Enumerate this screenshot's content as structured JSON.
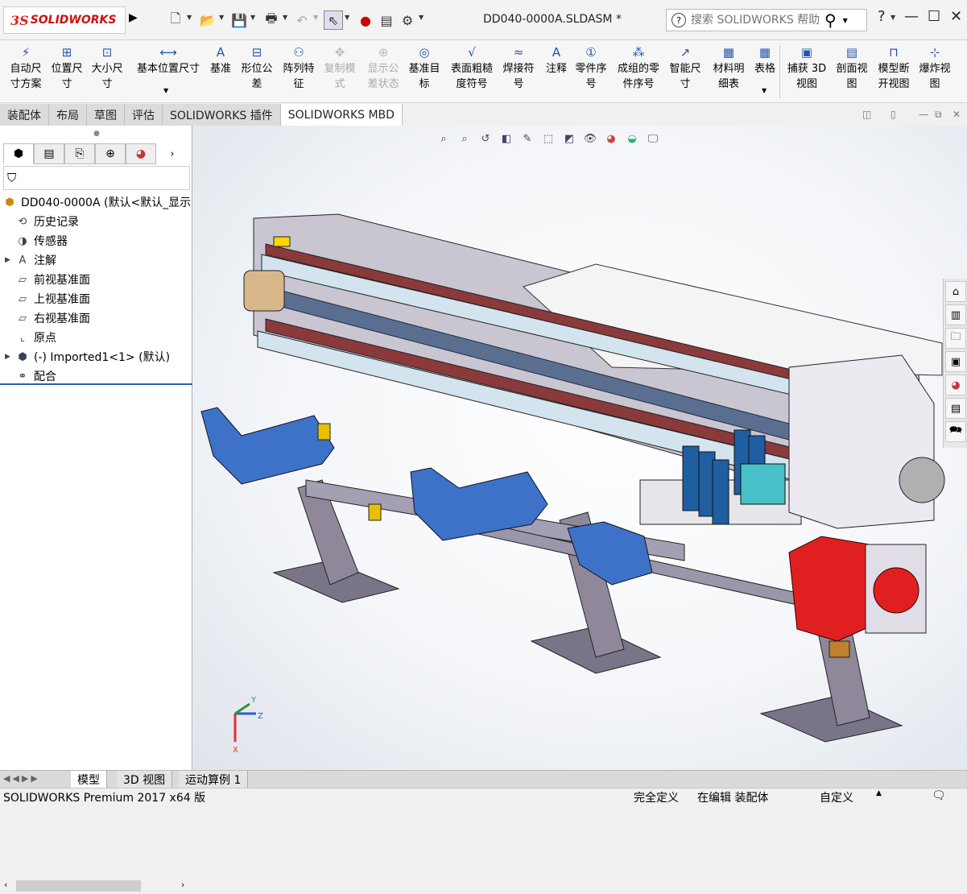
{
  "app": {
    "logo_prefix": "3S",
    "logo_text": "SOLIDWORKS",
    "document_title": "DD040-0000A.SLDASM *"
  },
  "search": {
    "placeholder": "搜索 SOLIDWORKS 帮助"
  },
  "window_controls": {
    "help": "?",
    "minimize": "—",
    "maximize": "☐",
    "close": "✕"
  },
  "ribbon": {
    "items": [
      {
        "label": "自动尺\n寸方案",
        "icon": "auto-dimension-icon"
      },
      {
        "label": "位置尺\n寸",
        "icon": "location-dimension-icon"
      },
      {
        "label": "大小尺\n寸",
        "icon": "size-dimension-icon"
      },
      {
        "label": "基本位置尺寸",
        "icon": "basic-location-dimension-icon"
      },
      {
        "label": "基准",
        "icon": "datum-icon"
      },
      {
        "label": "形位公\n差",
        "icon": "geometric-tolerance-icon"
      },
      {
        "label": "阵列特\n征",
        "icon": "pattern-feature-icon"
      },
      {
        "label": "复制模\n式",
        "icon": "copy-scheme-icon"
      },
      {
        "label": "显示公\n差状态",
        "icon": "show-tolerance-status-icon"
      },
      {
        "label": "基准目\n标",
        "icon": "datum-target-icon"
      },
      {
        "label": "表面粗糙\n度符号",
        "icon": "surface-finish-icon"
      },
      {
        "label": "焊接符\n号",
        "icon": "weld-symbol-icon"
      },
      {
        "label": "注释",
        "icon": "note-icon"
      },
      {
        "label": "零件序\n号",
        "icon": "balloon-icon"
      },
      {
        "label": "成组的零\n件序号",
        "icon": "stacked-balloon-icon"
      },
      {
        "label": "智能尺\n寸",
        "icon": "smart-dimension-icon"
      },
      {
        "label": "材料明\n细表",
        "icon": "bom-icon"
      },
      {
        "label": "表格",
        "icon": "table-icon"
      },
      {
        "label": "捕获 3D\n视图",
        "icon": "capture-3d-view-icon"
      },
      {
        "label": "剖面视\n图",
        "icon": "section-view-icon"
      },
      {
        "label": "模型断\n开视图",
        "icon": "model-break-view-icon"
      },
      {
        "label": "爆炸视\n图",
        "icon": "exploded-view-icon"
      }
    ]
  },
  "tabs": [
    "装配体",
    "布局",
    "草图",
    "评估",
    "SOLIDWORKS 插件",
    "SOLIDWORKS MBD"
  ],
  "active_tab": "SOLIDWORKS MBD",
  "tree": {
    "root": "DD040-0000A  (默认<默认_显示",
    "items": [
      "历史记录",
      "传感器",
      "注解",
      "前视基准面",
      "上视基准面",
      "右视基准面",
      "原点",
      "(-) Imported1<1> (默认)",
      "配合"
    ]
  },
  "bottom_tabs": [
    "模型",
    "3D 视图",
    "运动算例 1"
  ],
  "status": {
    "product": "SOLIDWORKS Premium 2017 x64 版",
    "definition": "完全定义",
    "editing": "在编辑 装配体",
    "units": "自定义"
  },
  "triad": {
    "y": "Y",
    "z": "Z",
    "x": "X"
  }
}
